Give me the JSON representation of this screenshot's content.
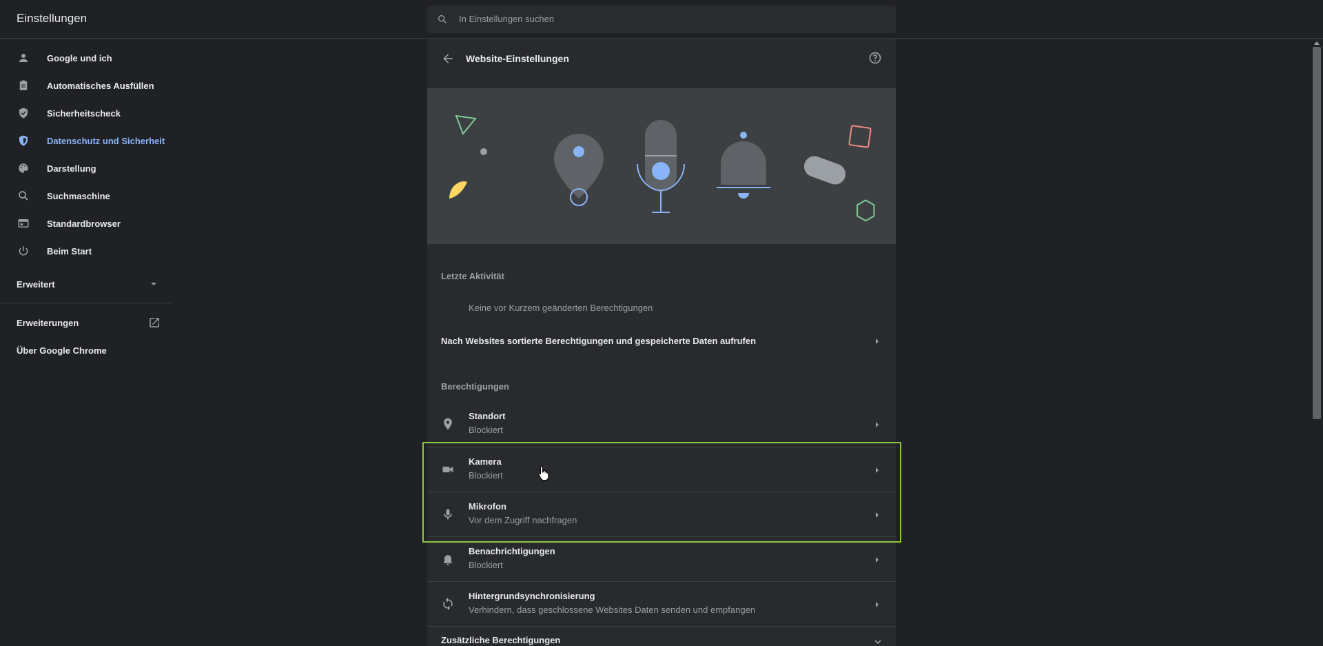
{
  "app": {
    "title": "Einstellungen"
  },
  "search": {
    "placeholder": "In Einstellungen suchen"
  },
  "sidebar": {
    "items": [
      {
        "label": "Google und ich",
        "icon": "person-icon"
      },
      {
        "label": "Automatisches Ausfüllen",
        "icon": "clipboard-icon"
      },
      {
        "label": "Sicherheitscheck",
        "icon": "shield-check-icon"
      },
      {
        "label": "Datenschutz und Sicherheit",
        "icon": "shield-icon",
        "active": true
      },
      {
        "label": "Darstellung",
        "icon": "palette-icon"
      },
      {
        "label": "Suchmaschine",
        "icon": "search-icon"
      },
      {
        "label": "Standardbrowser",
        "icon": "browser-icon"
      },
      {
        "label": "Beim Start",
        "icon": "power-icon"
      }
    ],
    "advanced": "Erweitert",
    "extensions": "Erweiterungen",
    "about": "Über Google Chrome"
  },
  "main": {
    "title": "Website-Einstellungen",
    "recent_heading": "Letzte Aktivität",
    "recent_empty": "Keine vor Kurzem geänderten Berechtigungen",
    "all_sites_link": "Nach Websites sortierte Berechtigungen und gespeicherte Daten aufrufen",
    "permissions_heading": "Berechtigungen",
    "permissions": [
      {
        "title": "Standort",
        "subtitle": "Blockiert",
        "icon": "location-icon"
      },
      {
        "title": "Kamera",
        "subtitle": "Blockiert",
        "icon": "camera-icon"
      },
      {
        "title": "Mikrofon",
        "subtitle": "Vor dem Zugriff nachfragen",
        "icon": "microphone-icon"
      },
      {
        "title": "Benachrichtigungen",
        "subtitle": "Blockiert",
        "icon": "bell-icon"
      },
      {
        "title": "Hintergrundsynchronisierung",
        "subtitle": "Verhindern, dass geschlossene Websites Daten senden und empfangen",
        "icon": "sync-icon"
      }
    ],
    "additional_permissions": "Zusätzliche Berechtigungen"
  },
  "colors": {
    "background": "#202124",
    "card": "#292a2d",
    "accent": "#8ab4f8",
    "highlight": "#8dc63f"
  }
}
